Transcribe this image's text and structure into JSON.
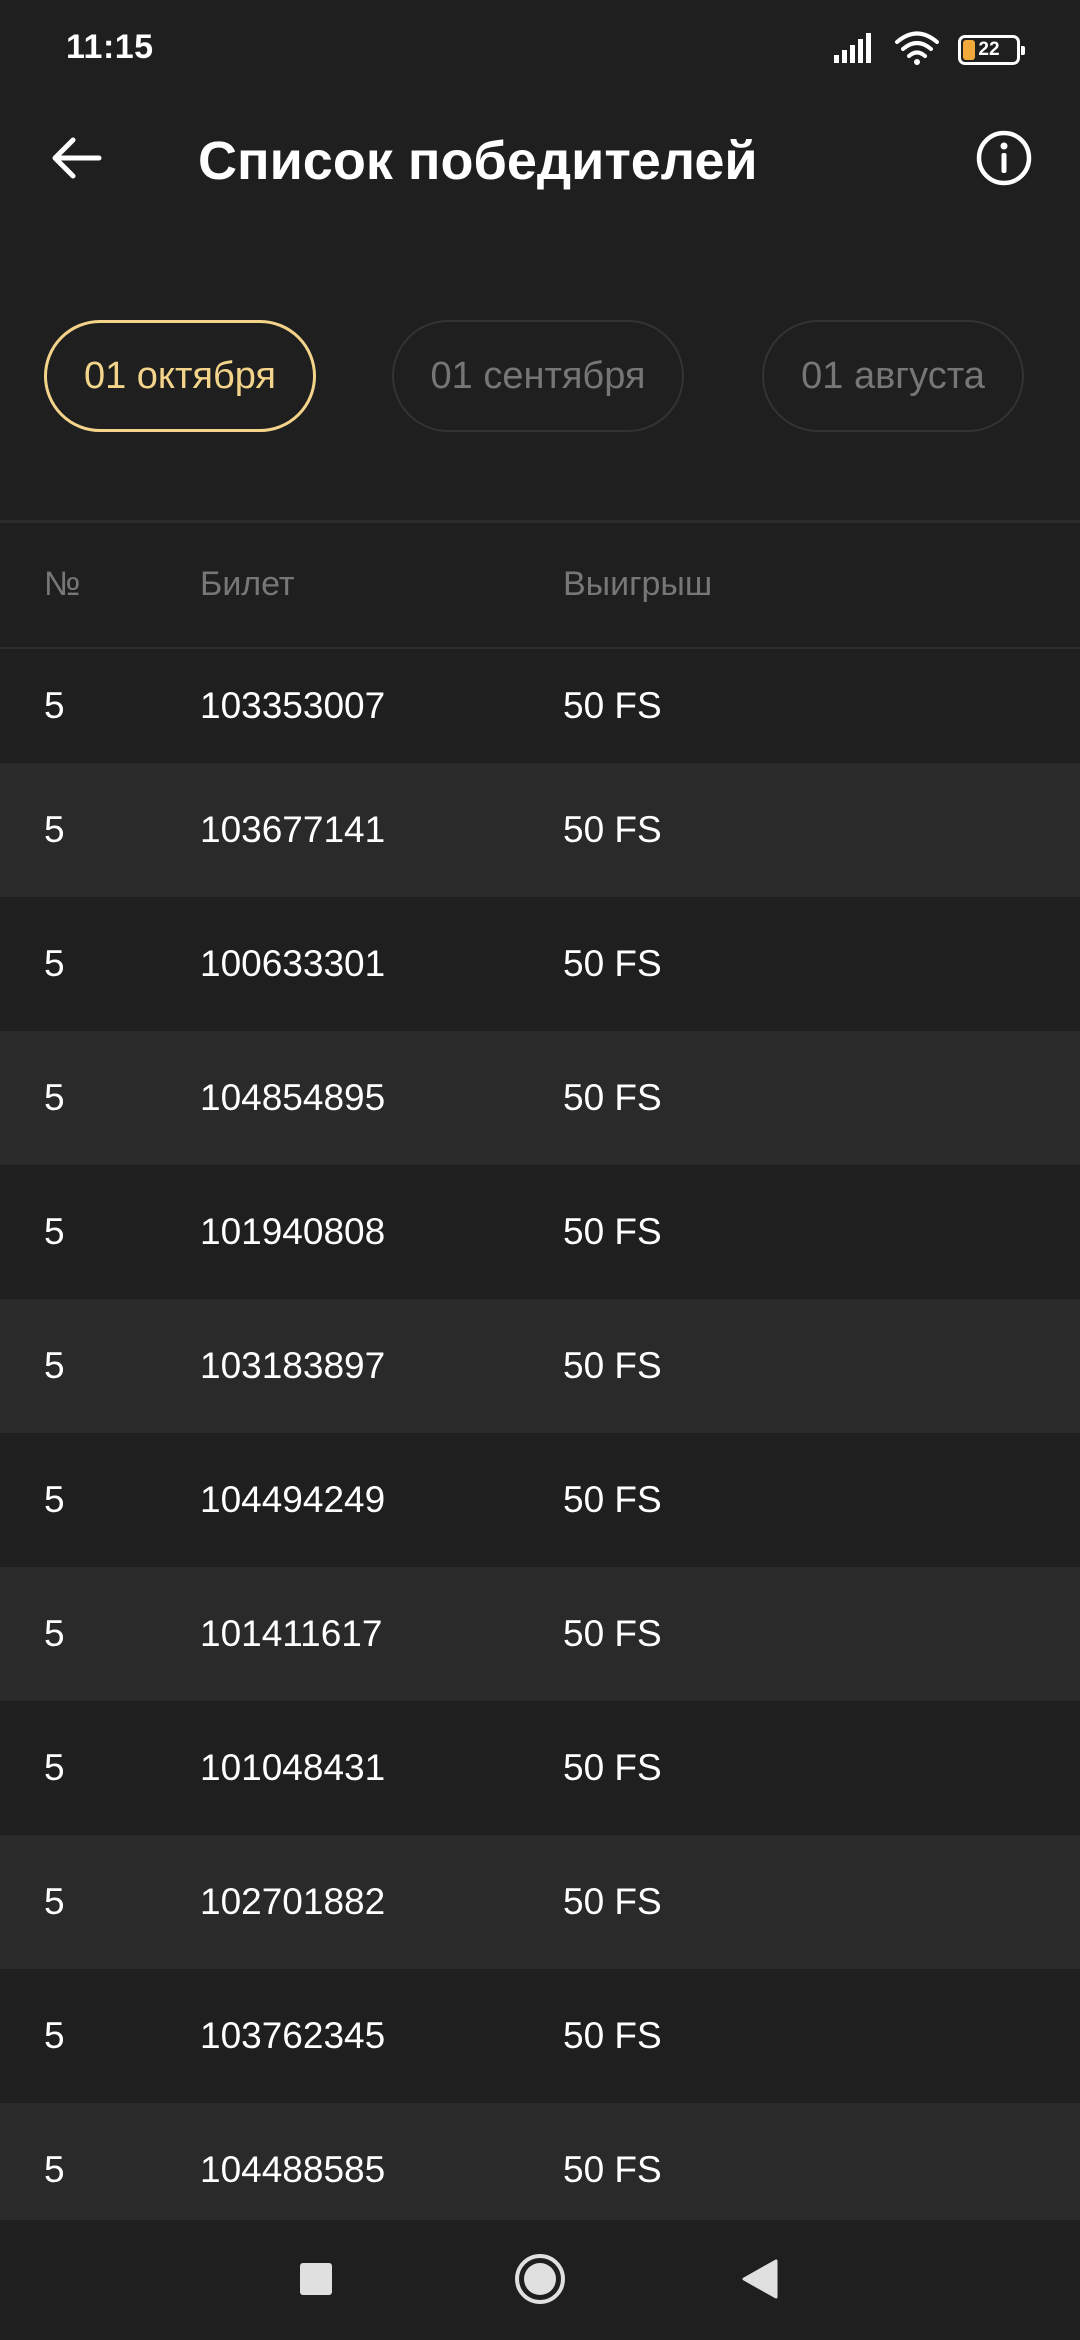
{
  "status_bar": {
    "time": "11:15",
    "battery_level": "22",
    "icons": [
      "signal-icon",
      "wifi-icon",
      "battery-icon"
    ]
  },
  "app_bar": {
    "title": "Список победителей",
    "back_icon": "arrow-left-icon",
    "info_icon": "info-icon"
  },
  "tabs": [
    {
      "label": "01 октября",
      "active": true
    },
    {
      "label": "01 сентября",
      "active": false
    },
    {
      "label": "01 августа",
      "active": false
    }
  ],
  "table": {
    "columns": [
      "№",
      "Билет",
      "Выигрыш"
    ],
    "rows": [
      {
        "num": "5",
        "ticket": "103353007",
        "prize": "50 FS"
      },
      {
        "num": "5",
        "ticket": "103677141",
        "prize": "50 FS"
      },
      {
        "num": "5",
        "ticket": "100633301",
        "prize": "50 FS"
      },
      {
        "num": "5",
        "ticket": "104854895",
        "prize": "50 FS"
      },
      {
        "num": "5",
        "ticket": "101940808",
        "prize": "50 FS"
      },
      {
        "num": "5",
        "ticket": "103183897",
        "prize": "50 FS"
      },
      {
        "num": "5",
        "ticket": "104494249",
        "prize": "50 FS"
      },
      {
        "num": "5",
        "ticket": "101411617",
        "prize": "50 FS"
      },
      {
        "num": "5",
        "ticket": "101048431",
        "prize": "50 FS"
      },
      {
        "num": "5",
        "ticket": "102701882",
        "prize": "50 FS"
      },
      {
        "num": "5",
        "ticket": "103762345",
        "prize": "50 FS"
      },
      {
        "num": "5",
        "ticket": "104488585",
        "prize": "50 FS"
      }
    ]
  },
  "colors": {
    "background": "#1f1f1f",
    "row_alt": "#2a2a2a",
    "accent": "#f3d48a",
    "muted_text": "#777777",
    "battery_fill": "#f2a93b"
  },
  "nav_bar": {
    "icons": [
      "square-recents-icon",
      "circle-home-icon",
      "triangle-back-icon"
    ]
  }
}
